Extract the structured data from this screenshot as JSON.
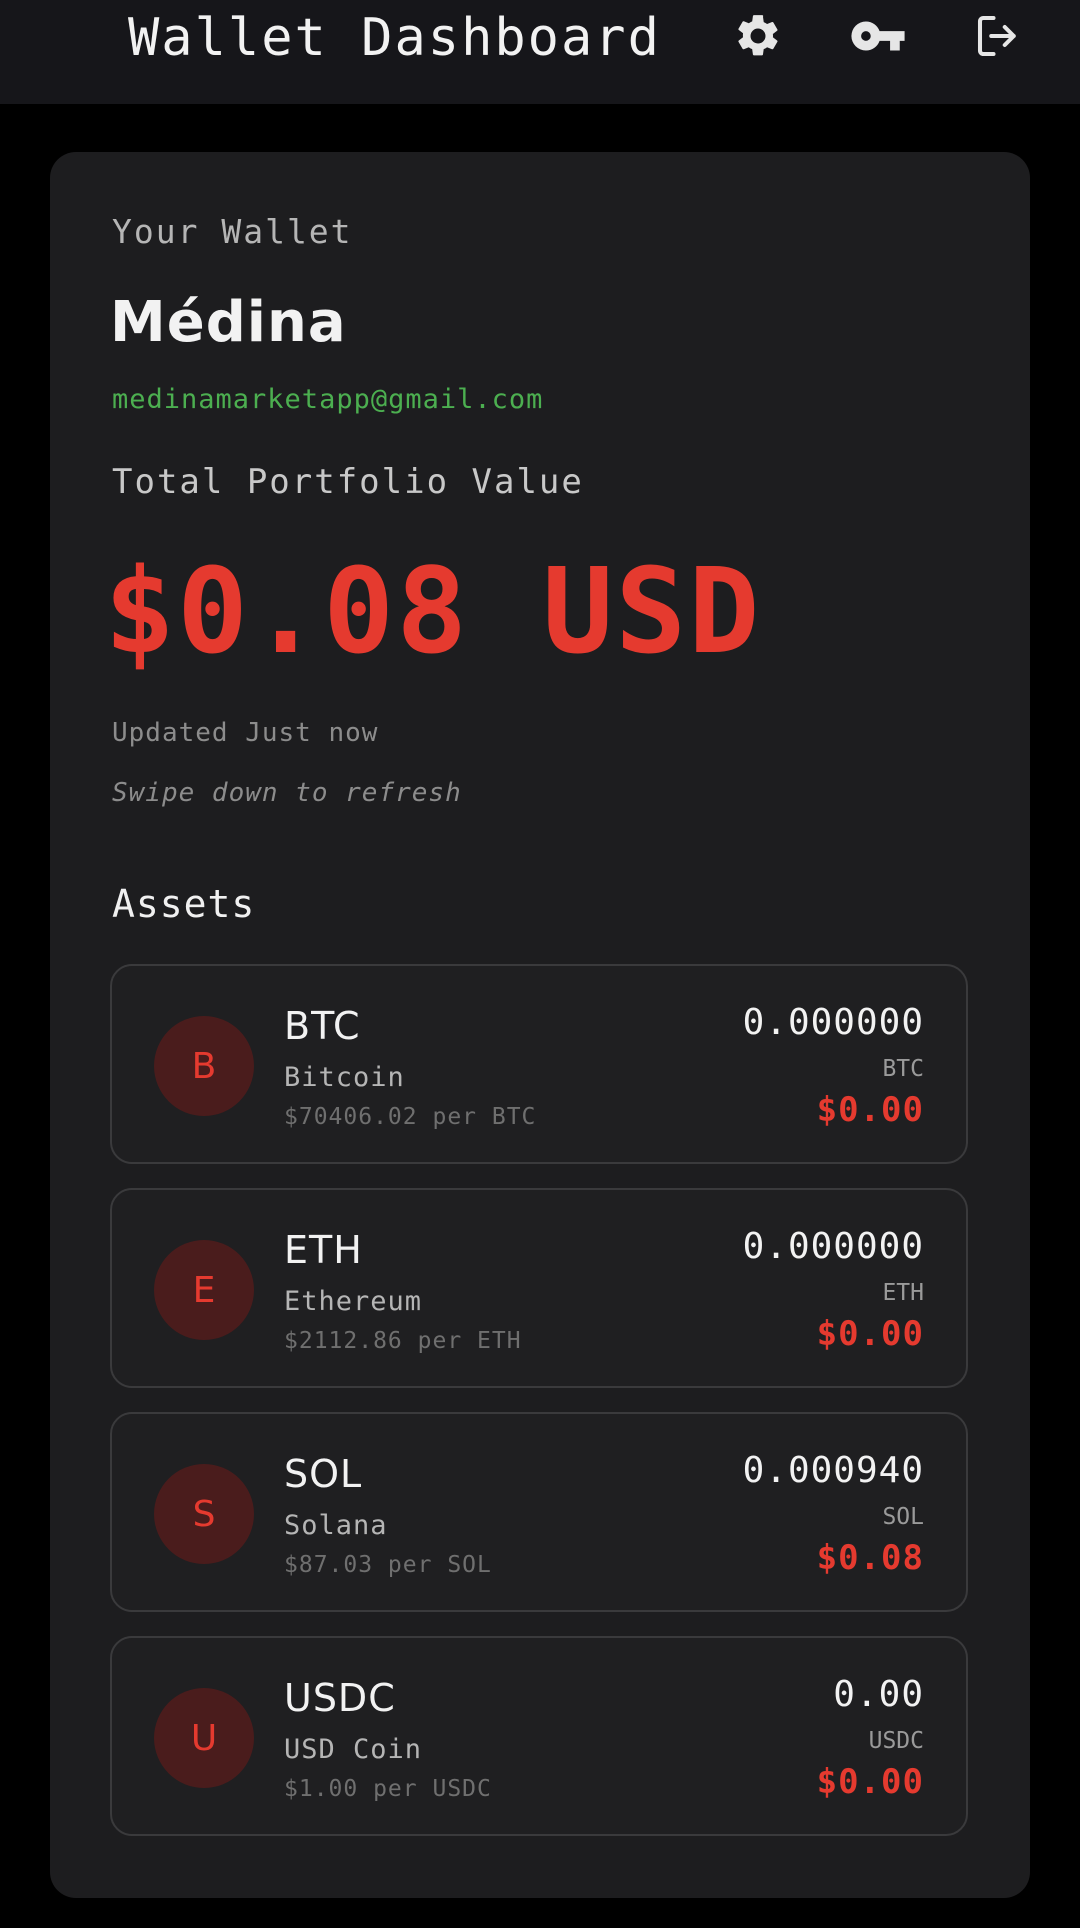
{
  "header": {
    "title": "Wallet Dashboard",
    "icons": [
      "gear-icon",
      "key-icon",
      "logout-icon"
    ]
  },
  "wallet": {
    "label": "Your Wallet",
    "name": "Médina",
    "email": "medinamarketapp@gmail.com"
  },
  "portfolio": {
    "label": "Total Portfolio Value",
    "value": "$0.08 USD",
    "updated": "Updated Just now",
    "refresh_hint": "Swipe down to refresh"
  },
  "assets": {
    "heading": "Assets",
    "items": [
      {
        "initial": "B",
        "symbol": "BTC",
        "name": "Bitcoin",
        "price": "$70406.02 per BTC",
        "amount": "0.000000",
        "unit": "BTC",
        "usd": "$0.00"
      },
      {
        "initial": "E",
        "symbol": "ETH",
        "name": "Ethereum",
        "price": "$2112.86 per ETH",
        "amount": "0.000000",
        "unit": "ETH",
        "usd": "$0.00"
      },
      {
        "initial": "S",
        "symbol": "SOL",
        "name": "Solana",
        "price": "$87.03 per SOL",
        "amount": "0.000940",
        "unit": "SOL",
        "usd": "$0.08"
      },
      {
        "initial": "U",
        "symbol": "USDC",
        "name": "USD Coin",
        "price": "$1.00 per USDC",
        "amount": "0.00",
        "unit": "USDC",
        "usd": "$0.00"
      }
    ]
  },
  "colors": {
    "accent": "#e53a2f",
    "email": "#4caf50",
    "background": "#000000",
    "card": "#1d1d1f"
  }
}
